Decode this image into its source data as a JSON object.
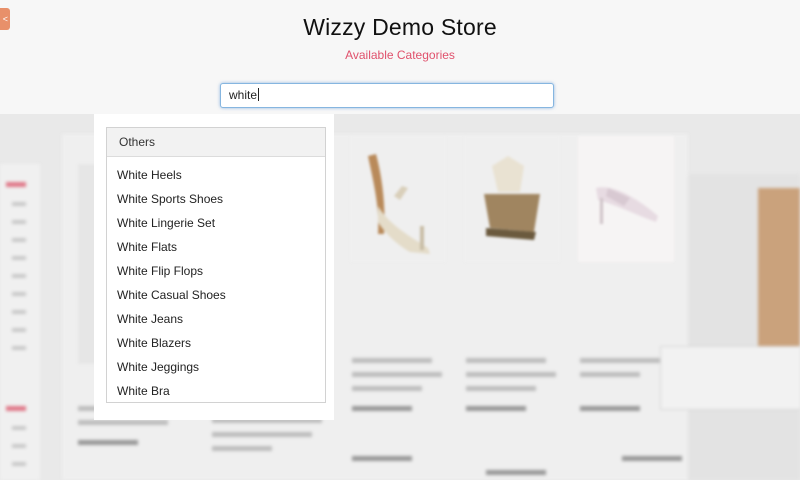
{
  "header": {
    "title": "Wizzy Demo Store",
    "subtitle": "Available Categories"
  },
  "search": {
    "value": "white"
  },
  "dropdown": {
    "section_title": "Others",
    "suggestions": [
      "White Heels",
      "White Sports Shoes",
      "White Lingerie Set",
      "White Flats",
      "White Flip Flops",
      "White Casual Shoes",
      "White Jeans",
      "White Blazers",
      "White Jeggings",
      "White Bra"
    ]
  },
  "colors": {
    "accent": "#e0516c",
    "search_border": "#86b6e0",
    "side_tab": "#e8906a"
  }
}
